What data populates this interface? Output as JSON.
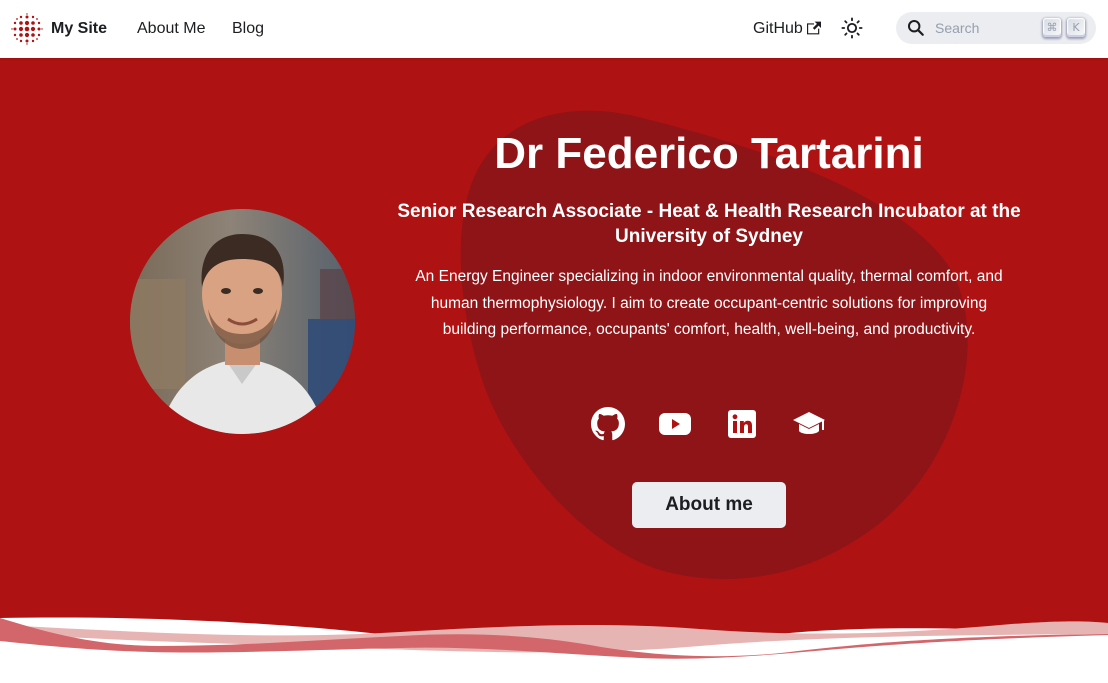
{
  "navbar": {
    "brand_title": "My Site",
    "links": {
      "about": "About Me",
      "blog": "Blog",
      "github": "GitHub"
    },
    "icons": {
      "logo": "dotted-circle-logo-icon",
      "external": "external-link-icon",
      "theme": "sun-icon",
      "search": "search-icon"
    },
    "search": {
      "placeholder": "Search",
      "shortcut_mod": "⌘",
      "shortcut_key": "K"
    }
  },
  "hero": {
    "title": "Dr Federico Tartarini",
    "subtitle": "Senior Research Associate - Heat & Health Research Incubator at the University of Sydney",
    "description": "An Energy Engineer specializing in indoor environmental quality, thermal comfort, and human thermophysiology. I aim to create occupant-centric solutions for improving building performance, occupants' comfort, health, well-being, and productivity.",
    "socials": [
      "github-icon",
      "youtube-icon",
      "linkedin-icon",
      "graduation-cap-icon"
    ],
    "button_label": "About me"
  },
  "colors": {
    "accent": "#ae1212",
    "blob": "#8e1417",
    "wave_light": "#e7b4b4",
    "wave_mid": "#d3666a",
    "button_bg": "#ebedf0",
    "text_dark": "#1c1e21"
  }
}
